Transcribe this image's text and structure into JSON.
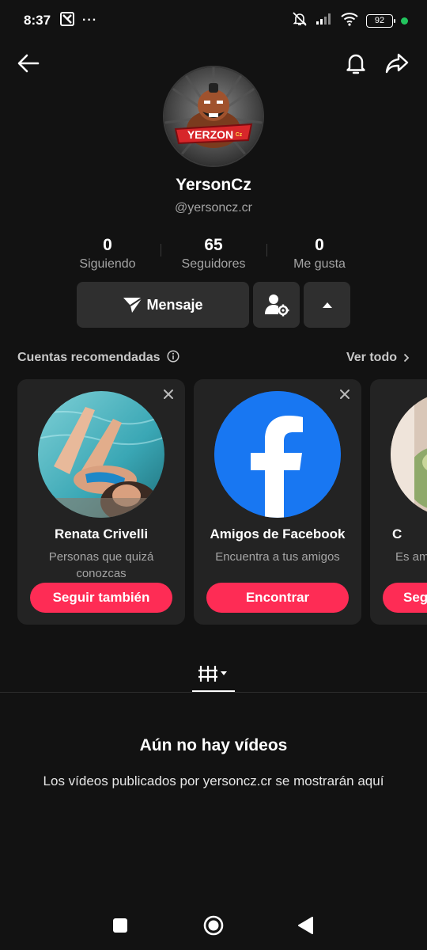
{
  "status_bar": {
    "time": "8:37",
    "notification_dots": "···",
    "battery": "92"
  },
  "profile": {
    "display_name": "YersonCz",
    "handle": "@yersoncz.cr",
    "avatar_text": "YERZON",
    "avatar_text_small": "Cz"
  },
  "stats": [
    {
      "value": "0",
      "label": "Siguiendo"
    },
    {
      "value": "65",
      "label": "Seguidores"
    },
    {
      "value": "0",
      "label": "Me gusta"
    }
  ],
  "actions": {
    "message_label": "Mensaje"
  },
  "recommendations": {
    "title": "Cuentas recomendadas",
    "see_all": "Ver todo",
    "cards": [
      {
        "name": "Renata Crivelli",
        "subtitle": "Personas que quizá conozcas",
        "button": "Seguir también"
      },
      {
        "name": "Amigos de Facebook",
        "subtitle": "Encuentra a tus amigos",
        "button": "Encontrar"
      },
      {
        "name": "C",
        "subtitle": "Es am",
        "button": "Seg"
      }
    ]
  },
  "empty_state": {
    "title": "Aún no hay vídeos",
    "description": "Los vídeos publicados por yersoncz.cr se mostrarán aquí"
  },
  "colors": {
    "background": "#121212",
    "accent": "#fe2c55",
    "card": "#232323",
    "facebook": "#1877f2"
  }
}
